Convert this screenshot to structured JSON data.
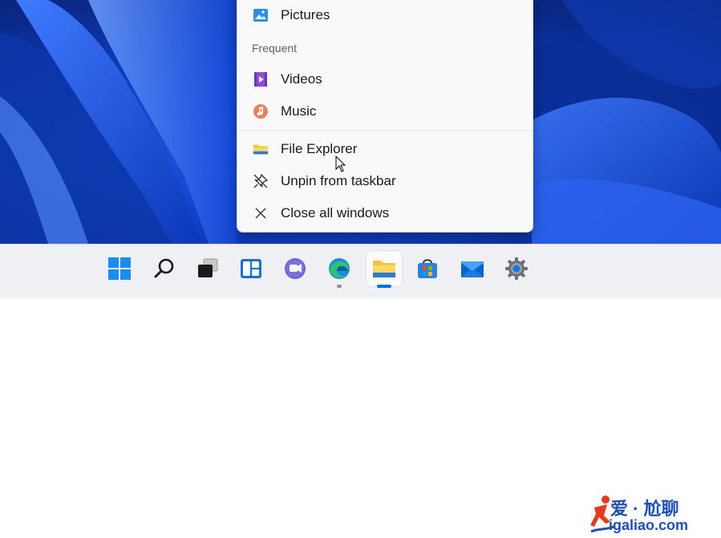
{
  "jumplist": {
    "pinned_item": "Pictures",
    "frequent_header": "Frequent",
    "frequent_items": [
      "Videos",
      "Music"
    ],
    "actions": {
      "file_explorer": "File Explorer",
      "unpin": "Unpin from taskbar",
      "close_all": "Close all windows"
    }
  },
  "taskbar": {
    "icons": [
      "start-icon",
      "search-icon",
      "task-view-icon",
      "widgets-icon",
      "teams-chat-icon",
      "edge-icon",
      "file-explorer-icon",
      "microsoft-store-icon",
      "mail-icon",
      "settings-icon"
    ],
    "active": "file-explorer-icon"
  },
  "watermark": {
    "line1": "爱 · 尬聊",
    "line2": "igaliao.com"
  },
  "colors": {
    "accent": "#0a6fd6",
    "desktop_blue": "#1e5cf0",
    "menu_bg": "#f9f9f9",
    "taskbar_bg": "#eef0f4"
  }
}
